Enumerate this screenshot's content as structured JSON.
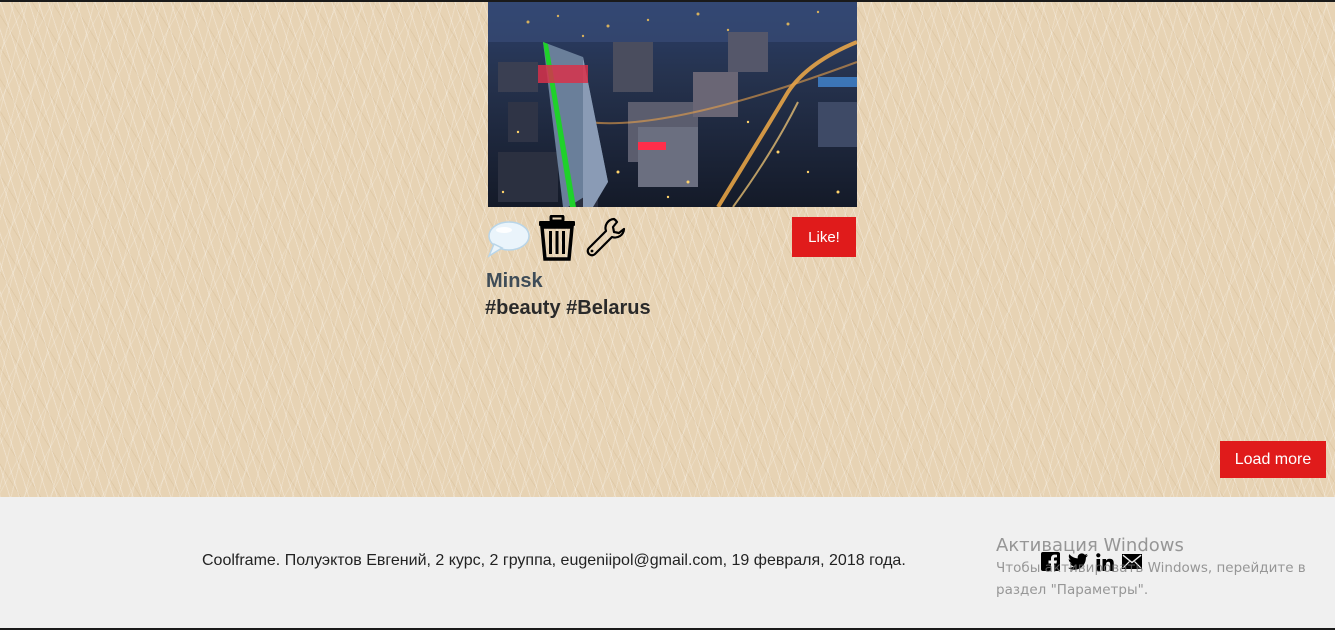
{
  "post": {
    "image_alt": "Minsk city at night",
    "title": "Minsk",
    "tags": "#beauty #Belarus",
    "actions": {
      "comment_icon": "speech-bubble-icon",
      "delete_icon": "trash-icon",
      "edit_icon": "wrench-icon"
    },
    "like_label": "Like!"
  },
  "load_more_label": "Load more",
  "footer": {
    "text": "Coolframe. Полуэктов Евгений, 2 курс, 2 группа, eugeniipol@gmail.com, 19 февраля, 2018 года.",
    "social_icons": [
      "facebook-icon",
      "twitter-icon",
      "linkedin-icon",
      "mail-icon"
    ]
  },
  "windows_activation": {
    "title": "Активация Windows",
    "line1": "Чтобы активировать Windows, перейдите в",
    "line2": "раздел \"Параметры\"."
  },
  "colors": {
    "accent_red": "#e01b1b",
    "background_texture": "#e7d3b4",
    "footer_bg": "#f0f0f0"
  }
}
